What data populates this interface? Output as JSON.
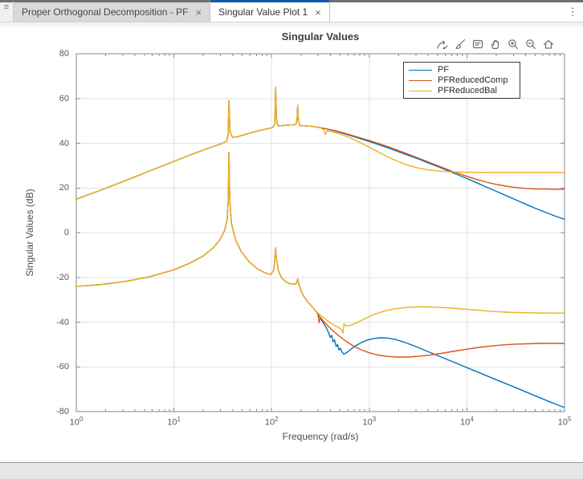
{
  "window": {
    "rail_glyph": "≡",
    "kebab_glyph": "⋮",
    "tabs": [
      {
        "label": "Proper Orthogonal Decomposition - PF",
        "close": "×",
        "active": false
      },
      {
        "label": "Singular Value Plot 1",
        "close": "×",
        "active": true
      }
    ]
  },
  "chart_data": {
    "type": "line",
    "title": "Singular Values",
    "xlabel": "Frequency (rad/s)",
    "ylabel": "Singular Values (dB)",
    "xscale": "log",
    "xlim_exponents": [
      0,
      5
    ],
    "xtick_exponents": [
      0,
      1,
      2,
      3,
      4,
      5
    ],
    "ylim": [
      -80,
      80
    ],
    "yticks": [
      -80,
      -60,
      -40,
      -20,
      0,
      20,
      40,
      60,
      80
    ],
    "grid": true,
    "legend": {
      "position": "northeast",
      "entries": [
        {
          "label": "PF",
          "color": "#0072BD"
        },
        {
          "label": "PFReducedComp",
          "color": "#D95319"
        },
        {
          "label": "PFReducedBal",
          "color": "#EDB120"
        }
      ]
    },
    "toolbar_icons": [
      "export-icon",
      "brush-icon",
      "datatip-icon",
      "pan-icon",
      "zoom-in-icon",
      "zoom-out-icon",
      "home-icon"
    ],
    "shared_segments": {
      "sigma1_common": [
        [
          0,
          15
        ],
        [
          0.25,
          19
        ],
        [
          0.5,
          23.2
        ],
        [
          0.75,
          27.6
        ],
        [
          1,
          31.9
        ],
        [
          1.2,
          35.3
        ],
        [
          1.35,
          37.7
        ],
        [
          1.48,
          39.7
        ],
        [
          1.54,
          40.9
        ],
        [
          1.556,
          44
        ],
        [
          1.563,
          59
        ],
        [
          1.575,
          45
        ],
        [
          1.6,
          42.7
        ],
        [
          1.65,
          42.9
        ],
        [
          1.75,
          44.2
        ],
        [
          1.85,
          45.4
        ],
        [
          1.95,
          46.4
        ],
        [
          2.01,
          47
        ],
        [
          2.033,
          48.5
        ],
        [
          2.041,
          65
        ],
        [
          2.052,
          49.5
        ],
        [
          2.07,
          47.7
        ],
        [
          2.12,
          47.9
        ],
        [
          2.17,
          48.1
        ],
        [
          2.22,
          48.2
        ],
        [
          2.25,
          48.4
        ],
        [
          2.263,
          52
        ],
        [
          2.267,
          57
        ],
        [
          2.275,
          50
        ],
        [
          2.29,
          47.9
        ],
        [
          2.34,
          47.8
        ],
        [
          2.4,
          47.6
        ],
        [
          2.44,
          47.4
        ],
        [
          2.48,
          47.1
        ]
      ],
      "sigma2_common": [
        [
          0,
          -24
        ],
        [
          0.25,
          -23.2
        ],
        [
          0.5,
          -21.8
        ],
        [
          0.75,
          -19.7
        ],
        [
          1,
          -16.6
        ],
        [
          1.15,
          -13.9
        ],
        [
          1.3,
          -10.4
        ],
        [
          1.4,
          -6.9
        ],
        [
          1.47,
          -3.2
        ],
        [
          1.52,
          1
        ],
        [
          1.545,
          6
        ],
        [
          1.556,
          14
        ],
        [
          1.563,
          36
        ],
        [
          1.572,
          14
        ],
        [
          1.59,
          4
        ],
        [
          1.63,
          -3
        ],
        [
          1.69,
          -8.5
        ],
        [
          1.77,
          -13
        ],
        [
          1.85,
          -16
        ],
        [
          1.93,
          -17.9
        ],
        [
          1.99,
          -18.7
        ],
        [
          2.02,
          -17
        ],
        [
          2.033,
          -12
        ],
        [
          2.041,
          -6.8
        ],
        [
          2.05,
          -12
        ],
        [
          2.07,
          -17
        ],
        [
          2.1,
          -20
        ],
        [
          2.14,
          -21.8
        ],
        [
          2.18,
          -22.7
        ],
        [
          2.22,
          -23.1
        ],
        [
          2.25,
          -22.8
        ],
        [
          2.261,
          -21.8
        ],
        [
          2.267,
          -20.7
        ],
        [
          2.278,
          -23
        ],
        [
          2.3,
          -25.8
        ],
        [
          2.33,
          -28.5
        ],
        [
          2.37,
          -30.9
        ],
        [
          2.41,
          -32.9
        ],
        [
          2.44,
          -34.3
        ]
      ]
    },
    "series": [
      {
        "name": "PF-sigma1",
        "legend": "PF",
        "color": "#0072BD",
        "base": "sigma1_common",
        "points": [
          [
            2.56,
            46.4
          ],
          [
            2.64,
            45.6
          ],
          [
            2.72,
            44.6
          ],
          [
            2.8,
            43.5
          ],
          [
            2.9,
            42.2
          ],
          [
            3,
            40.8
          ],
          [
            3.1,
            39.3
          ],
          [
            3.2,
            37.8
          ],
          [
            3.3,
            36.2
          ],
          [
            3.4,
            34.6
          ],
          [
            3.5,
            33
          ],
          [
            3.6,
            31.3
          ],
          [
            3.7,
            29.6
          ],
          [
            3.8,
            27.8
          ],
          [
            3.9,
            26
          ],
          [
            4,
            24.2
          ],
          [
            4.1,
            22.3
          ],
          [
            4.2,
            20.4
          ],
          [
            4.3,
            18.5
          ],
          [
            4.4,
            16.6
          ],
          [
            4.5,
            14.7
          ],
          [
            4.6,
            12.8
          ],
          [
            4.7,
            10.9
          ],
          [
            4.8,
            9.2
          ],
          [
            4.9,
            7.5
          ],
          [
            5,
            6
          ]
        ]
      },
      {
        "name": "PF-sigma2",
        "legend": "PF",
        "color": "#0072BD",
        "base": "sigma2_common",
        "points": [
          [
            2.47,
            -36.2
          ],
          [
            2.5,
            -38.2
          ],
          [
            2.53,
            -40.3
          ],
          [
            2.56,
            -42.5
          ],
          [
            2.585,
            -44.8
          ],
          [
            2.6,
            -46.8
          ],
          [
            2.615,
            -45.9
          ],
          [
            2.63,
            -48.8
          ],
          [
            2.645,
            -47.9
          ],
          [
            2.66,
            -50.9
          ],
          [
            2.675,
            -50
          ],
          [
            2.69,
            -52.4
          ],
          [
            2.705,
            -51.7
          ],
          [
            2.72,
            -53.3
          ],
          [
            2.74,
            -54.3
          ],
          [
            2.77,
            -53.6
          ],
          [
            2.81,
            -52.2
          ],
          [
            2.86,
            -50.6
          ],
          [
            2.92,
            -49.1
          ],
          [
            2.98,
            -48
          ],
          [
            3.05,
            -47.3
          ],
          [
            3.12,
            -47
          ],
          [
            3.19,
            -47.1
          ],
          [
            3.27,
            -47.8
          ],
          [
            3.36,
            -49
          ],
          [
            3.46,
            -50.6
          ],
          [
            3.56,
            -52.4
          ],
          [
            3.66,
            -54.2
          ],
          [
            3.76,
            -56
          ],
          [
            3.86,
            -57.8
          ],
          [
            3.96,
            -59.6
          ],
          [
            4.06,
            -61.4
          ],
          [
            4.16,
            -63.2
          ],
          [
            4.26,
            -65
          ],
          [
            4.36,
            -66.8
          ],
          [
            4.46,
            -68.6
          ],
          [
            4.56,
            -70.4
          ],
          [
            4.66,
            -72.2
          ],
          [
            4.76,
            -74
          ],
          [
            4.86,
            -75.8
          ],
          [
            4.93,
            -77
          ],
          [
            5,
            -78.2
          ]
        ]
      },
      {
        "name": "PFReducedComp-sigma1",
        "legend": "PFReducedComp",
        "color": "#D95319",
        "base": "sigma1_common",
        "points": [
          [
            2.56,
            46.4
          ],
          [
            2.64,
            45.7
          ],
          [
            2.72,
            44.8
          ],
          [
            2.8,
            43.8
          ],
          [
            2.9,
            42.5
          ],
          [
            3,
            41.2
          ],
          [
            3.1,
            39.8
          ],
          [
            3.2,
            38.3
          ],
          [
            3.3,
            36.7
          ],
          [
            3.4,
            35.1
          ],
          [
            3.5,
            33.4
          ],
          [
            3.6,
            31.7
          ],
          [
            3.7,
            30
          ],
          [
            3.8,
            28.3
          ],
          [
            3.9,
            26.7
          ],
          [
            4,
            25.2
          ],
          [
            4.1,
            23.8
          ],
          [
            4.2,
            22.6
          ],
          [
            4.3,
            21.6
          ],
          [
            4.4,
            20.8
          ],
          [
            4.5,
            20.2
          ],
          [
            4.6,
            19.8
          ],
          [
            4.7,
            19.6
          ],
          [
            4.8,
            19.5
          ],
          [
            4.9,
            19.4
          ],
          [
            5,
            19.4
          ]
        ]
      },
      {
        "name": "PFReducedComp-sigma2",
        "legend": "PFReducedComp",
        "color": "#D95319",
        "base": "sigma2_common",
        "points": [
          [
            2.46,
            -35.5
          ],
          [
            2.475,
            -36.4
          ],
          [
            2.487,
            -40.3
          ],
          [
            2.5,
            -37.9
          ],
          [
            2.53,
            -39.5
          ],
          [
            2.58,
            -41.8
          ],
          [
            2.64,
            -44.3
          ],
          [
            2.7,
            -46.5
          ],
          [
            2.77,
            -48.8
          ],
          [
            2.84,
            -50.7
          ],
          [
            2.92,
            -52.4
          ],
          [
            3,
            -53.7
          ],
          [
            3.09,
            -54.7
          ],
          [
            3.18,
            -55.3
          ],
          [
            3.28,
            -55.6
          ],
          [
            3.4,
            -55.6
          ],
          [
            3.52,
            -55.2
          ],
          [
            3.64,
            -54.6
          ],
          [
            3.76,
            -53.8
          ],
          [
            3.88,
            -52.9
          ],
          [
            4,
            -52.1
          ],
          [
            4.12,
            -51.3
          ],
          [
            4.24,
            -50.7
          ],
          [
            4.36,
            -50.2
          ],
          [
            4.48,
            -49.9
          ],
          [
            4.6,
            -49.7
          ],
          [
            4.75,
            -49.5
          ],
          [
            5,
            -49.5
          ]
        ]
      },
      {
        "name": "PFReducedBal-sigma1",
        "legend": "PFReducedBal",
        "color": "#EDB120",
        "base": "sigma1_common",
        "points": [
          [
            2.51,
            46.7
          ],
          [
            2.535,
            45.9
          ],
          [
            2.55,
            43.9
          ],
          [
            2.565,
            45.5
          ],
          [
            2.6,
            45.3
          ],
          [
            2.68,
            44.4
          ],
          [
            2.76,
            43.2
          ],
          [
            2.84,
            41.7
          ],
          [
            2.92,
            40
          ],
          [
            3,
            38.2
          ],
          [
            3.1,
            35.9
          ],
          [
            3.2,
            33.7
          ],
          [
            3.3,
            31.7
          ],
          [
            3.4,
            30.1
          ],
          [
            3.5,
            28.9
          ],
          [
            3.6,
            28.1
          ],
          [
            3.7,
            27.6
          ],
          [
            3.8,
            27.3
          ],
          [
            3.9,
            27.1
          ],
          [
            4,
            27
          ],
          [
            4.15,
            26.9
          ],
          [
            4.35,
            26.9
          ],
          [
            4.6,
            26.9
          ],
          [
            5,
            26.9
          ]
        ]
      },
      {
        "name": "PFReducedBal-sigma2",
        "legend": "PFReducedBal",
        "color": "#EDB120",
        "base": "sigma2_common",
        "points": [
          [
            2.47,
            -35.8
          ],
          [
            2.52,
            -37.6
          ],
          [
            2.57,
            -39.3
          ],
          [
            2.62,
            -40.8
          ],
          [
            2.67,
            -42
          ],
          [
            2.71,
            -43
          ],
          [
            2.733,
            -44.9
          ],
          [
            2.74,
            -40.7
          ],
          [
            2.76,
            -41.7
          ],
          [
            2.8,
            -41.5
          ],
          [
            2.86,
            -40.5
          ],
          [
            2.93,
            -39
          ],
          [
            3,
            -37.5
          ],
          [
            3.08,
            -36.1
          ],
          [
            3.16,
            -35
          ],
          [
            3.24,
            -34.2
          ],
          [
            3.32,
            -33.7
          ],
          [
            3.4,
            -33.4
          ],
          [
            3.5,
            -33.2
          ],
          [
            3.6,
            -33.2
          ],
          [
            3.7,
            -33.4
          ],
          [
            3.8,
            -33.6
          ],
          [
            3.9,
            -33.9
          ],
          [
            4,
            -34.3
          ],
          [
            4.1,
            -34.6
          ],
          [
            4.2,
            -35
          ],
          [
            4.3,
            -35.3
          ],
          [
            4.4,
            -35.5
          ],
          [
            4.5,
            -35.7
          ],
          [
            4.6,
            -35.8
          ],
          [
            4.75,
            -35.9
          ],
          [
            5,
            -36
          ]
        ]
      }
    ]
  }
}
